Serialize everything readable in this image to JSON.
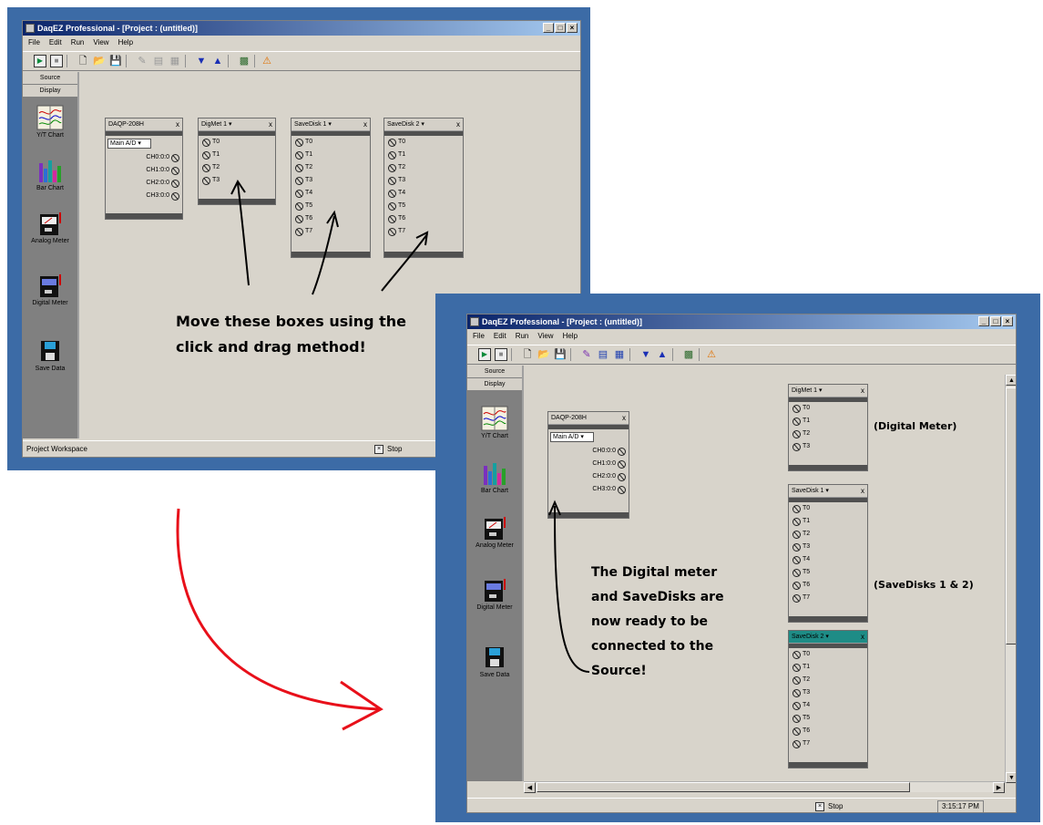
{
  "window": {
    "title": "DaqEZ Professional - [Project : (untitled)]",
    "controls": [
      "_",
      "□",
      "×"
    ]
  },
  "menu": [
    "File",
    "Edit",
    "Run",
    "View",
    "Help"
  ],
  "toolbar_icons": [
    "run-icon",
    "stop-icon",
    "new-file-icon",
    "open-folder-icon",
    "save-disk-icon",
    "wand-icon",
    "table-icon",
    "chart-icon",
    "down-arrow-icon",
    "up-arrow-icon",
    "module-icon",
    "warning-icon"
  ],
  "sidebar": {
    "tabs": [
      "Source",
      "Display"
    ],
    "tools": [
      {
        "label": "Y/T Chart",
        "icon": "yt-chart-icon"
      },
      {
        "label": "Bar Chart",
        "icon": "bar-chart-icon"
      },
      {
        "label": "Analog Meter",
        "icon": "analog-meter-icon"
      },
      {
        "label": "Digital Meter",
        "icon": "digital-meter-icon"
      },
      {
        "label": "Save Data",
        "icon": "save-data-icon"
      }
    ]
  },
  "boxes": {
    "source": {
      "title": "DAQP-208H",
      "mode": "Main A/D ▾",
      "channels": [
        "CH0:0:0",
        "CH1:0:0",
        "CH2:0:0",
        "CH3:0:0"
      ]
    },
    "digmet": {
      "title": "DigMet 1 ▾",
      "channels": [
        "T0",
        "T1",
        "T2",
        "T3"
      ]
    },
    "savedisk1": {
      "title": "SaveDisk 1 ▾",
      "channels": [
        "T0",
        "T1",
        "T2",
        "T3",
        "T4",
        "T5",
        "T6",
        "T7"
      ]
    },
    "savedisk2": {
      "title": "SaveDisk 2 ▾",
      "channels": [
        "T0",
        "T1",
        "T2",
        "T3",
        "T4",
        "T5",
        "T6",
        "T7"
      ]
    },
    "close": "x"
  },
  "status": {
    "left_text": "Project Workspace",
    "stop_label": "Stop",
    "time": "3:15:17 PM"
  },
  "annotations": {
    "move_line1": "Move these boxes using the",
    "move_line2": "click and drag method!",
    "ready_lines": [
      "The Digital meter",
      "and SaveDisks are",
      "now ready to be",
      "connected to the",
      "Source!"
    ],
    "digital_meter_label": "(Digital Meter)",
    "savedisks_label": "(SaveDisks 1 & 2)"
  },
  "colors": {
    "frame_blue": "#3c6ba6",
    "title_gradient_start": "#0a246a",
    "arrow_red": "#e8101a",
    "selected_teal": "#1e8c86"
  }
}
